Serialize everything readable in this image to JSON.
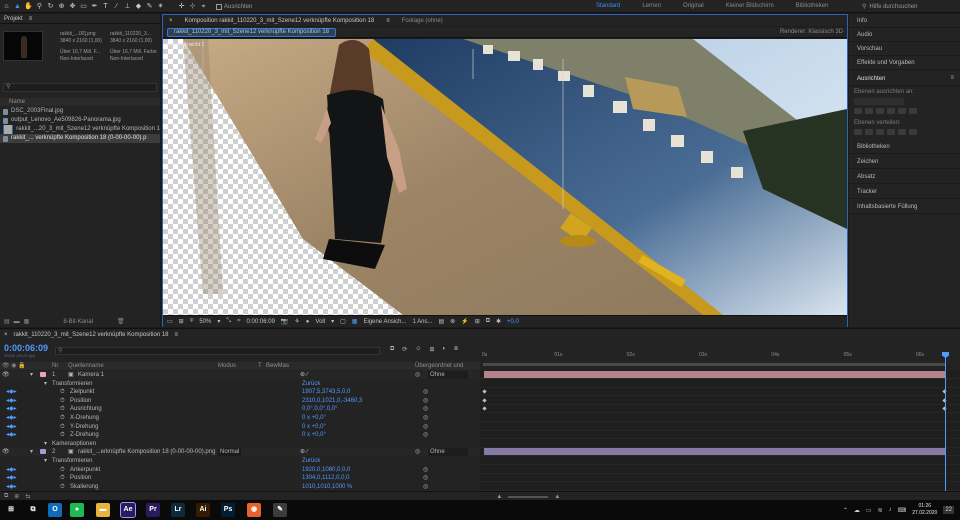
{
  "topbar": {
    "align_label": "Ausrichten",
    "workspaces": [
      "Standard",
      "Lernen",
      "Original",
      "Kleiner Bildschirm",
      "Bibliotheken"
    ],
    "search_placeholder": "Hilfe durchsuchen"
  },
  "project": {
    "title": "Projekt",
    "thumb_name": "rakkit_...00].png",
    "thumb_dims": "3840 x 2160 (1,00)",
    "thumb_colors": "Über 16,7 Mill. F...",
    "thumb_mode": "Non-Interlaced",
    "ref_name": "rakkit_110220_3...",
    "ref_dims": "3840 x 2160 (1,00)",
    "ref_colors": "Über 16,7 Mill. Farbe",
    "ref_mode": "Non-Interlaced",
    "list_header": "Name",
    "items": [
      "DSC_2003Final.jpg",
      "output_Lenovo_Ae509826-Panorama.jpg",
      "rakkit_...20_3_mit_Szene12 verknüpfte Komposition 1",
      "rakkit_... verknüpfte Komposition 18 (0-00-00-00).p"
    ],
    "footer": "8-Bit-Kanal"
  },
  "comp": {
    "tab_label": "Komposition rakkit_110220_3_mit_Szene12 verknüpfte Komposition 18",
    "footage_tab": "Footage (ohne)",
    "crumb": "rakkit_110220_3_mit_Szene12 verknüpfte Komposition 18",
    "renderer_label": "Renderer:",
    "renderer_value": "Klassisch 3D",
    "view_label": "Eigene Ansicht 1",
    "zoom": "50%",
    "timecode": "0:00:06:09",
    "quality": "Voll",
    "view_select": "Eigene Ansich...",
    "views": "1 Ans...",
    "exposure": "+0,0"
  },
  "right_panel": {
    "items": [
      "Info",
      "Audio",
      "Vorschau",
      "Effekte und Vorgaben",
      "Ausrichten",
      "Bibliotheken",
      "Zeichen",
      "Absatz",
      "Tracker",
      "Inhaltsbasierte Füllung"
    ],
    "align_to_label": "Ebenen ausrichten an:",
    "distribute_label": "Ebenen verteilen:"
  },
  "timeline": {
    "tab_label": "rakkit_110220_3_mit_Szene12 verknüpfte Komposition 18",
    "timecode": "0:00:06:09",
    "timecode_sub": "00159 (25,00 fps)",
    "col_nr": "Nr.",
    "col_name": "Quellenname",
    "col_mode": "Modus",
    "col_t": "T",
    "col_bewmas": "BewMas",
    "col_parent": "Übergeordnet und verkn...",
    "ticks": [
      "0s",
      "01s",
      "02s",
      "03s",
      "04s",
      "05s",
      "06s"
    ],
    "layers": [
      {
        "kind": "layer",
        "nr": "1",
        "name": "Kamera 1",
        "color": "#e8a6b0",
        "parent": "Ohne"
      },
      {
        "kind": "group",
        "name": "Transformieren",
        "value": "Zurück"
      },
      {
        "kind": "prop",
        "name": "Zielpunkt",
        "value": "1907,5,3743,5,0,0"
      },
      {
        "kind": "prop",
        "name": "Position",
        "value": "2310,0,1021,0,-3460,3"
      },
      {
        "kind": "prop",
        "name": "Ausrichtung",
        "value": "0,0°,0,0°,0,0°"
      },
      {
        "kind": "prop",
        "name": "X-Drehung",
        "value": "0 x +0,0°"
      },
      {
        "kind": "prop",
        "name": "Y-Drehung",
        "value": "0 x +0,0°"
      },
      {
        "kind": "prop",
        "name": "Z-Drehung",
        "value": "0 x +0,0°"
      },
      {
        "kind": "group",
        "name": "Kameraoptionen",
        "value": ""
      },
      {
        "kind": "layer",
        "nr": "2",
        "name": "rakkit_...erknüpfte Komposition 18 (0-00-00-00).png",
        "color": "#a89bd0",
        "mode": "Normal",
        "parent": "Ohne"
      },
      {
        "kind": "group",
        "name": "Transformieren",
        "value": "Zurück"
      },
      {
        "kind": "prop",
        "name": "Ankerpunkt",
        "value": "1920,0,1080,0,0,0"
      },
      {
        "kind": "prop",
        "name": "Position",
        "value": "1304,0,1112,0,0,0"
      },
      {
        "kind": "prop",
        "name": "Skalierung",
        "value": "1010,1010,1000 %"
      }
    ]
  },
  "taskbar": {
    "icons": [
      {
        "name": "windows-icon",
        "glyph": "⊞",
        "color": "#0a0a0a"
      },
      {
        "name": "task-view-icon",
        "glyph": "⧉",
        "color": "#0a0a0a"
      },
      {
        "name": "outlook-icon",
        "glyph": "O",
        "color": "#0f6cbd"
      },
      {
        "name": "spotify-icon",
        "glyph": "●",
        "color": "#1db954"
      },
      {
        "name": "explorer-icon",
        "glyph": "▬",
        "color": "#e8b43c"
      },
      {
        "name": "after-effects-icon",
        "glyph": "Ae",
        "color": "#2a1a5e"
      },
      {
        "name": "premiere-icon",
        "glyph": "Pr",
        "color": "#2a1a5e"
      },
      {
        "name": "lightroom-icon",
        "glyph": "Lr",
        "color": "#0c2a3c"
      },
      {
        "name": "illustrator-icon",
        "glyph": "Ai",
        "color": "#331a00"
      },
      {
        "name": "photoshop-icon",
        "glyph": "Ps",
        "color": "#001e36"
      },
      {
        "name": "firefox-icon",
        "glyph": "◉",
        "color": "#e6642b"
      },
      {
        "name": "notes-icon",
        "glyph": "✎",
        "color": "#3c3c3c"
      }
    ],
    "time": "01:26",
    "date": "27.02.2020",
    "notif": "22"
  }
}
